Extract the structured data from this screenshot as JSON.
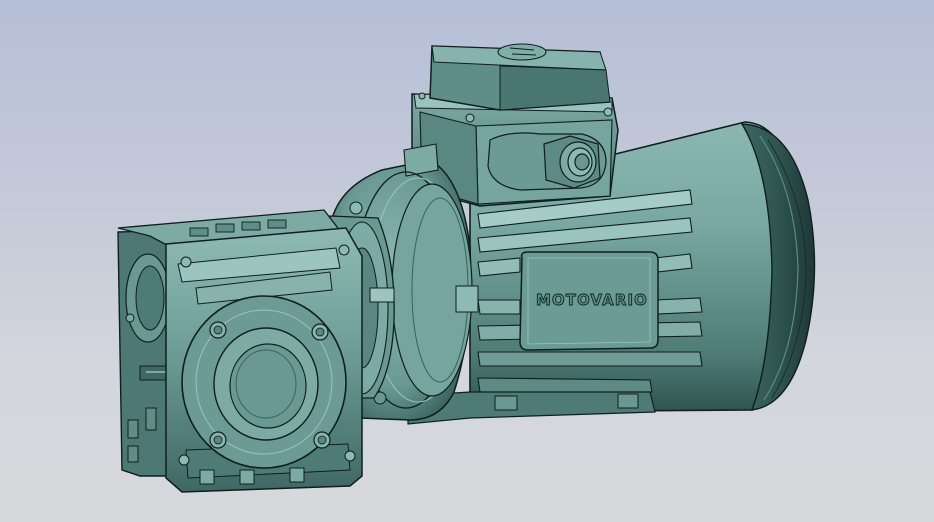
{
  "model": {
    "nameplate_text": "MOTOVARIO",
    "body_color": "#6f9e98",
    "shadow_color": "#2f5450",
    "highlight_color": "#9cc5bf",
    "edge_color": "#0f1f1e"
  },
  "background": {
    "top_color": "#b6bfd8",
    "bottom_color": "#d7d8dc"
  }
}
